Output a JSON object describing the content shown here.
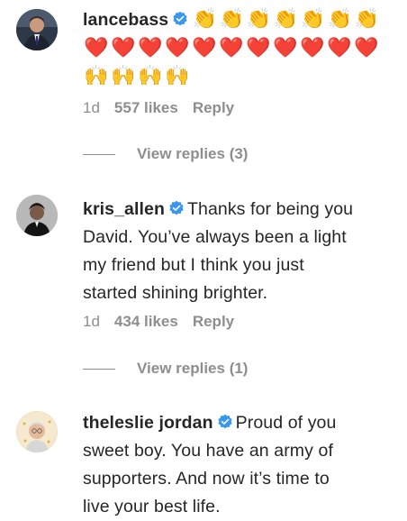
{
  "comments": [
    {
      "username": "lancebass",
      "verified": true,
      "text": "",
      "emoji_lines": [
        [
          "👏",
          "👏",
          "👏",
          "👏",
          "👏",
          "👏",
          "👏"
        ],
        [
          "❤️",
          "❤️",
          "❤️",
          "❤️",
          "❤️",
          "❤️",
          "❤️",
          "❤️",
          "❤️",
          "❤️",
          "❤️"
        ],
        [
          "🙌",
          "🙌",
          "🙌",
          "🙌"
        ]
      ],
      "time": "1d",
      "likes": "557 likes",
      "reply": "Reply",
      "view_replies": "View replies (3)"
    },
    {
      "username": "kris_allen",
      "verified": true,
      "text_lines": [
        "Thanks for being you",
        "David. You’ve always been a light",
        "my friend but I think you just",
        "started shining brighter."
      ],
      "time": "1d",
      "likes": "434 likes",
      "reply": "Reply",
      "view_replies": "View replies (1)"
    },
    {
      "username": "theleslie jordan",
      "verified": true,
      "text_lines": [
        "Proud of you",
        "sweet boy. You have an army of",
        "supporters. And now it’s time to",
        "live your best life."
      ]
    }
  ],
  "colors": {
    "text": "#262626",
    "muted": "#8e8e8e",
    "verified_blue": "#3897f0"
  }
}
